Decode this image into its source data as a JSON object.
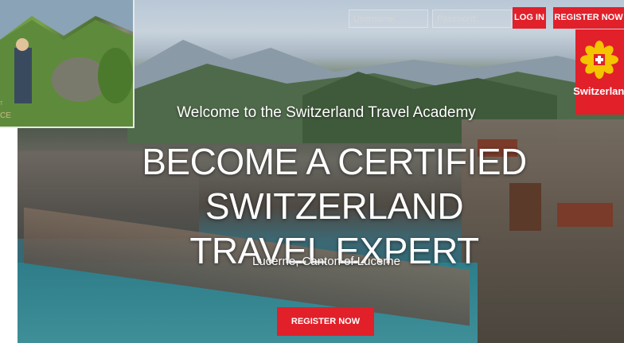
{
  "topbar": {
    "username_placeholder": "Username:",
    "password_placeholder": "Password:",
    "login_label": "LOG IN",
    "register_label": "REGISTER NOW"
  },
  "logo": {
    "text": "Switzerland."
  },
  "hero": {
    "welcome": "Welcome to the Switzerland Travel Academy",
    "headline_line1": "BECOME A CERTIFIED SWITZERLAND",
    "headline_line2": "TRAVEL EXPERT",
    "location": "Lucerne, Canton of Lucerne",
    "cta_label": "REGISTER NOW"
  },
  "inset": {
    "edge_text_top": "T",
    "edge_text_bottom": "CE"
  },
  "colors": {
    "accent": "#e1202a",
    "text": "#ffffff"
  },
  "icons": {
    "logo_flower": "edelweiss-icon",
    "logo_cross": "swiss-cross-icon"
  }
}
